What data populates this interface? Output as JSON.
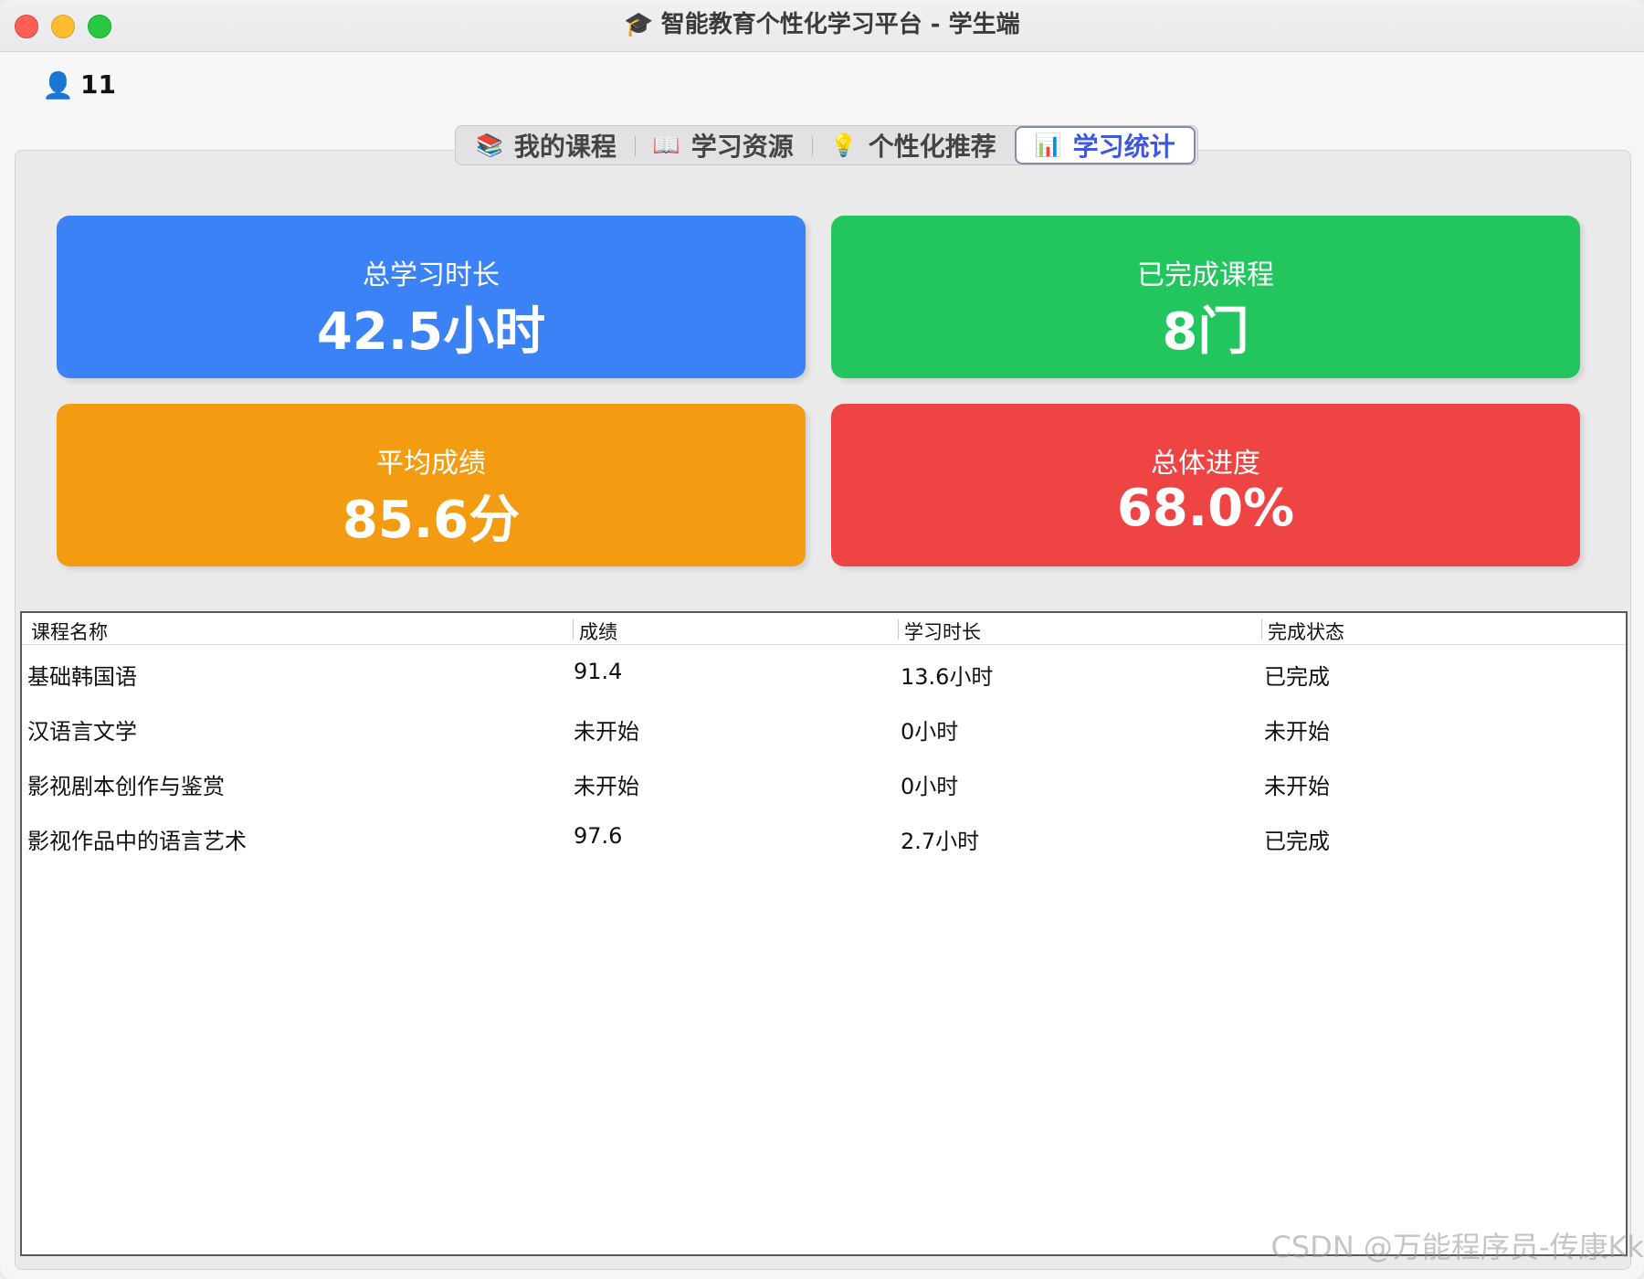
{
  "window": {
    "title": "智能教育个性化学习平台 - 学生端",
    "title_icon": "🎓"
  },
  "user": {
    "icon": "👤",
    "name": "11"
  },
  "tabs": [
    {
      "icon": "📚",
      "label": "我的课程",
      "active": false
    },
    {
      "icon": "📖",
      "label": "学习资源",
      "active": false
    },
    {
      "icon": "💡",
      "label": "个性化推荐",
      "active": false
    },
    {
      "icon": "📊",
      "label": "学习统计",
      "active": true
    }
  ],
  "stats": {
    "total_time": {
      "label": "总学习时长",
      "value": "42.5小时",
      "color": "#3b82f6"
    },
    "completed": {
      "label": "已完成课程",
      "value": "8门",
      "color": "#23c55e"
    },
    "avg_score": {
      "label": "平均成绩",
      "value": "85.6分",
      "color": "#f39c12"
    },
    "progress": {
      "label": "总体进度",
      "value": "68.0%",
      "color": "#ef4444"
    }
  },
  "table": {
    "columns": [
      "课程名称",
      "成绩",
      "学习时长",
      "完成状态"
    ],
    "rows": [
      [
        "基础韩国语",
        "91.4",
        "13.6小时",
        "已完成"
      ],
      [
        "汉语言文学",
        "未开始",
        "0小时",
        "未开始"
      ],
      [
        "影视剧本创作与鉴赏",
        "未开始",
        "0小时",
        "未开始"
      ],
      [
        "影视作品中的语言艺术",
        "97.6",
        "2.7小时",
        "已完成"
      ]
    ]
  },
  "watermark": "CSDN @万能程序员-传康Kk"
}
